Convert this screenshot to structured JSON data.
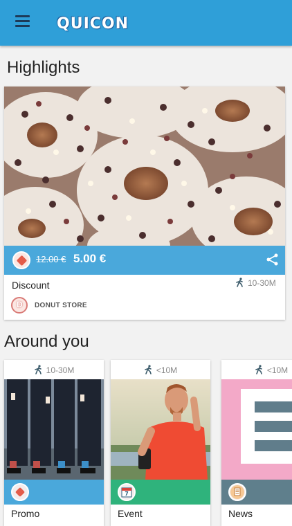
{
  "header": {
    "logo_text": "QUICON",
    "menu_icon": "hamburger-menu-icon"
  },
  "highlights": {
    "title": "Highlights",
    "card": {
      "old_price": "12.00 €",
      "new_price": "5.00 €",
      "distance": "10-30M",
      "type": "Discount",
      "store": "DONUT STORE"
    }
  },
  "around": {
    "title": "Around you",
    "cards": [
      {
        "distance": "10-30M",
        "label": "Promo",
        "bar_color": "#4aa8db",
        "icon": "tag-icon"
      },
      {
        "distance": "<10M",
        "label": "Event",
        "bar_color": "#2fb37c",
        "icon": "calendar-icon"
      },
      {
        "distance": "<10M",
        "label": "News",
        "bar_color": "#5f7f8c",
        "icon": "document-icon"
      }
    ]
  },
  "colors": {
    "header": "#2f9fd8",
    "price_bar": "#4aa8db",
    "accent_tag": "#e35c4a"
  }
}
